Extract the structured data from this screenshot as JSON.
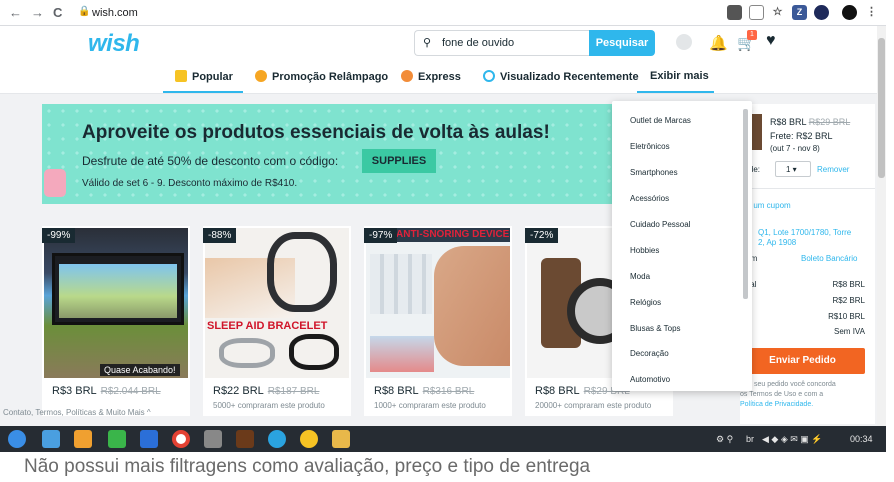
{
  "browser": {
    "url": "wish.com",
    "back_icon": "←",
    "forward_icon": "→",
    "reload_icon": "C",
    "ext_z": "Z"
  },
  "header": {
    "logo": "wish",
    "search_value": "fone de ouvido",
    "search_button": "Pesquisar",
    "cart_count": "1",
    "tabs": [
      {
        "label": "Popular"
      },
      {
        "label": "Promoção Relâmpago"
      },
      {
        "label": "Express"
      },
      {
        "label": "Visualizado Recentemente"
      },
      {
        "label": "Exibir mais"
      }
    ]
  },
  "banner": {
    "title": "Aproveite os produtos essenciais de volta às aulas!",
    "subtitle": "Desfrute de até 50% de desconto com o código:",
    "code": "SUPPLIES",
    "valid": "Válido de set 6 - 9. Desconto máximo de R$410."
  },
  "products": [
    {
      "discount": "-99%",
      "price": "R$3 BRL",
      "old_price": "R$2.044 BRL",
      "sold": "",
      "overlay": "Quase Acabando!"
    },
    {
      "discount": "-88%",
      "price": "R$22 BRL",
      "old_price": "R$187 BRL",
      "sold": "5000+ compraram este produto",
      "overlay": "SLEEP AID BRACELET"
    },
    {
      "discount": "-97%",
      "price": "R$8 BRL",
      "old_price": "R$316 BRL",
      "sold": "1000+ compraram este produto",
      "overlay": "ANTI-SNORING DEVICE"
    },
    {
      "discount": "-72%",
      "price": "R$8 BRL",
      "old_price": "R$29 BRL",
      "sold": "20000+ compraram este produto",
      "overlay": ""
    }
  ],
  "dropdown": {
    "items": [
      "Outlet de Marcas",
      "Eletrônicos",
      "Smartphones",
      "Acessórios",
      "Cuidado Pessoal",
      "Hobbies",
      "Moda",
      "Relógios",
      "Blusas & Tops",
      "Decoração",
      "Automotivo"
    ]
  },
  "cart_panel": {
    "price": "R$8 BRL",
    "old_price": "R$29 BRL",
    "shipping": "Frete: R$2 BRL",
    "delivery": "(out 7 - nov 8)",
    "qty_label": "dade:",
    "qty_value": "1",
    "remove": "Remover",
    "coupon": "car um cupom",
    "address_1": "Q1, Lote 1700/1780, Torre",
    "address_2": "2, Ap 1908",
    "payment_prefix": ".com",
    "payment": "Boleto Bancário",
    "total_label": "tal",
    "rows": [
      "R$8 BRL",
      "R$2 BRL",
      "R$10 BRL",
      "Sem IVA"
    ],
    "send_button": "Enviar Pedido",
    "terms_1": "ar o seu pedido você concorda",
    "terms_2": "os Termos de Uso e com a",
    "terms_3": "Política de Privacidade."
  },
  "footer_link": "Contato, Termos, Políticas & Muito Mais ^",
  "taskbar": {
    "lang": "br",
    "clock": "00:34"
  },
  "caption": "Não possui mais filtragens como avaliação, preço e tipo de entrega",
  "colors": {
    "brand": "#2fb7ec",
    "banner_bg": "#7fe3cf",
    "code_bg": "#3bc9a3",
    "send_button": "#f26522",
    "taskbar": "#262c33"
  }
}
